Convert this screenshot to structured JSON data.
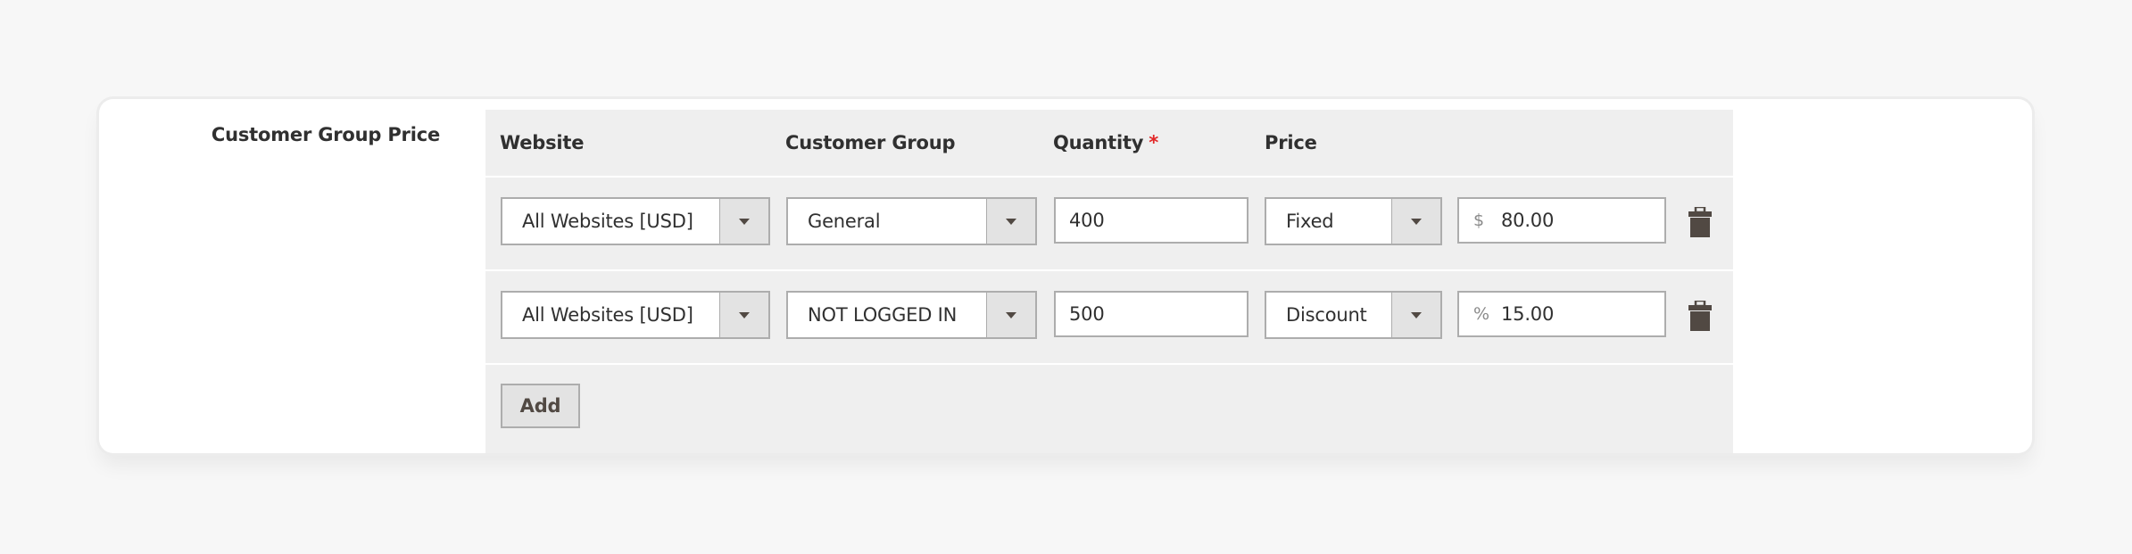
{
  "field": {
    "label": "Customer Group Price"
  },
  "columns": {
    "website": "Website",
    "customer_group": "Customer Group",
    "quantity": "Quantity",
    "quantity_required_mark": "*",
    "price": "Price"
  },
  "rows": [
    {
      "website": "All Websites [USD]",
      "customer_group": "General",
      "quantity": "400",
      "price_type": "Fixed",
      "price_symbol": "$",
      "price_value": "80.00",
      "delete_icon": "trash-icon"
    },
    {
      "website": "All Websites [USD]",
      "customer_group": "NOT LOGGED IN",
      "quantity": "500",
      "price_type": "Discount",
      "price_symbol": "%",
      "price_value": "15.00",
      "delete_icon": "trash-icon"
    }
  ],
  "actions": {
    "add_label": "Add"
  },
  "colors": {
    "required": "#e22626",
    "icon": "#514943",
    "grid_background": "#efefef"
  }
}
